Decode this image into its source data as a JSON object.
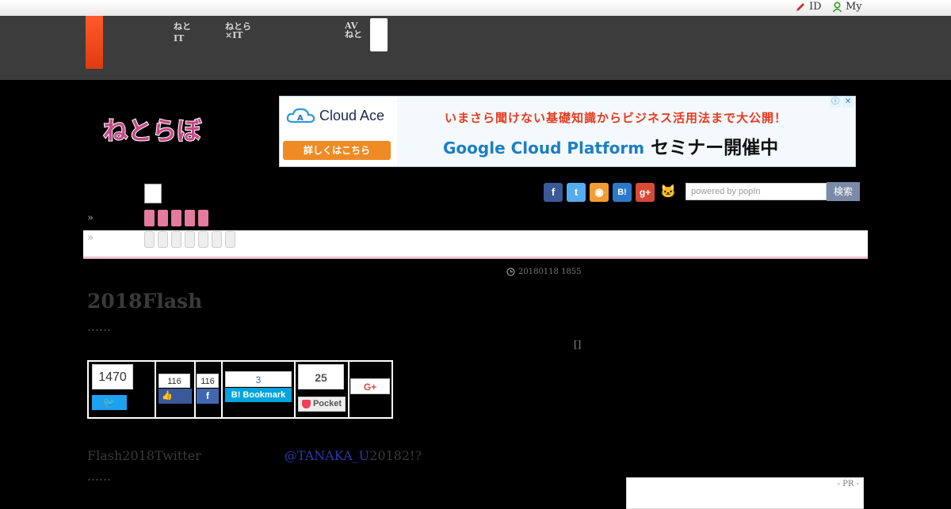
{
  "topbar": {
    "id_label": "ID",
    "my_label": "My"
  },
  "global_nav": {
    "items": [
      {
        "line1": "ねと",
        "line2": "IT"
      },
      {
        "line1": "ねとら",
        "line2": "×IT"
      },
      {
        "line1": "AV",
        "line2": "ねと"
      }
    ]
  },
  "header": {
    "logo_text": "ねとらぼ",
    "ad": {
      "brand": "Cloud Ace",
      "button": "詳しくはこちら",
      "headline": "いまさら聞けない基礎知識からビジネス活用法まで大公開！",
      "product": "Google Cloud Platform",
      "event": "セミナー開催中",
      "info_icon": "ⓘ",
      "close_icon": "✕"
    }
  },
  "social_icons": [
    {
      "name": "facebook-icon",
      "glyph": "f",
      "color": "#3b5998"
    },
    {
      "name": "twitter-icon",
      "glyph": "t",
      "color": "#55acee"
    },
    {
      "name": "rss-icon",
      "glyph": "◉",
      "color": "#f39c33"
    },
    {
      "name": "hatena-icon",
      "glyph": "B!",
      "color": "#2b7ac9"
    },
    {
      "name": "googleplus-icon",
      "glyph": "g+",
      "color": "#d74a36"
    },
    {
      "name": "cat-icon",
      "glyph": "🐱",
      "color": "#8a5ad0"
    }
  ],
  "search": {
    "placeholder": "powered by popIn",
    "button": "検索"
  },
  "breadcrumb": {
    "marker1": "»",
    "marker2": "»"
  },
  "article": {
    "date": "20180118 1855",
    "title": "2018Flash",
    "lead_dots": "……",
    "bracket": "[]",
    "paragraph_pre": "Flash2018Twitter",
    "paragraph_link": "@TANAKA_U",
    "paragraph_post": "20182!?",
    "trail_dots": "……"
  },
  "share": {
    "twitter_count": "1470",
    "facebook_like_count": "116",
    "facebook_share_count": "116",
    "hatena_count": "3",
    "hatena_label": "B! Bookmark",
    "pocket_count": "25",
    "pocket_label": "Pocket",
    "gplus_label": "G+"
  },
  "sidebar": {
    "pr_label": "- PR -"
  }
}
